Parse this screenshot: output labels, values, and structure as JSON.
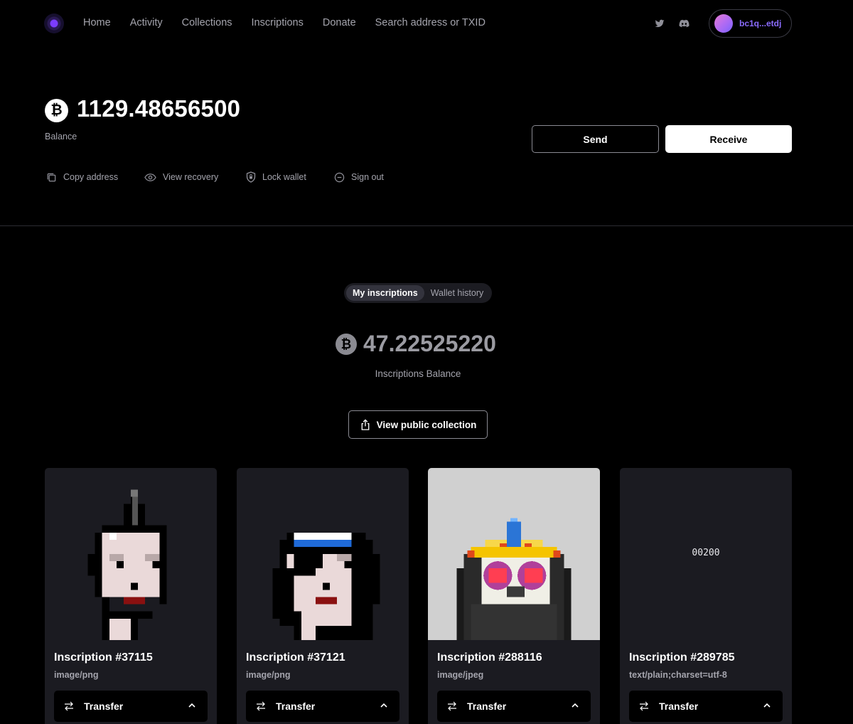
{
  "nav": {
    "links": [
      "Home",
      "Activity",
      "Collections",
      "Inscriptions",
      "Donate",
      "Search address or TXID"
    ],
    "wallet_address": "bc1q...etdj"
  },
  "balance": {
    "amount": "1129.48656500",
    "label": "Balance",
    "currency_symbol": "₿"
  },
  "buttons": {
    "send": "Send",
    "receive": "Receive"
  },
  "actions": {
    "copy": "Copy address",
    "recovery": "View recovery",
    "lock": "Lock wallet",
    "signout": "Sign out"
  },
  "tabs": {
    "items": [
      "My inscriptions",
      "Wallet history"
    ],
    "active": "My inscriptions"
  },
  "inscriptions_balance": {
    "amount": "47.22525220",
    "label": "Inscriptions Balance"
  },
  "public_collection_label": "View public collection",
  "cards": [
    {
      "title": "Inscription #37115",
      "mime": "image/png",
      "transfer": "Transfer"
    },
    {
      "title": "Inscription #37121",
      "mime": "image/png",
      "transfer": "Transfer"
    },
    {
      "title": "Inscription #288116",
      "mime": "image/jpeg",
      "transfer": "Transfer"
    },
    {
      "title": "Inscription #289785",
      "mime": "text/plain;charset=utf-8",
      "transfer": "Transfer",
      "text_content": "00200"
    }
  ],
  "colors": {
    "accent": "#8b6cff",
    "card_bg": "#1b1b21"
  }
}
